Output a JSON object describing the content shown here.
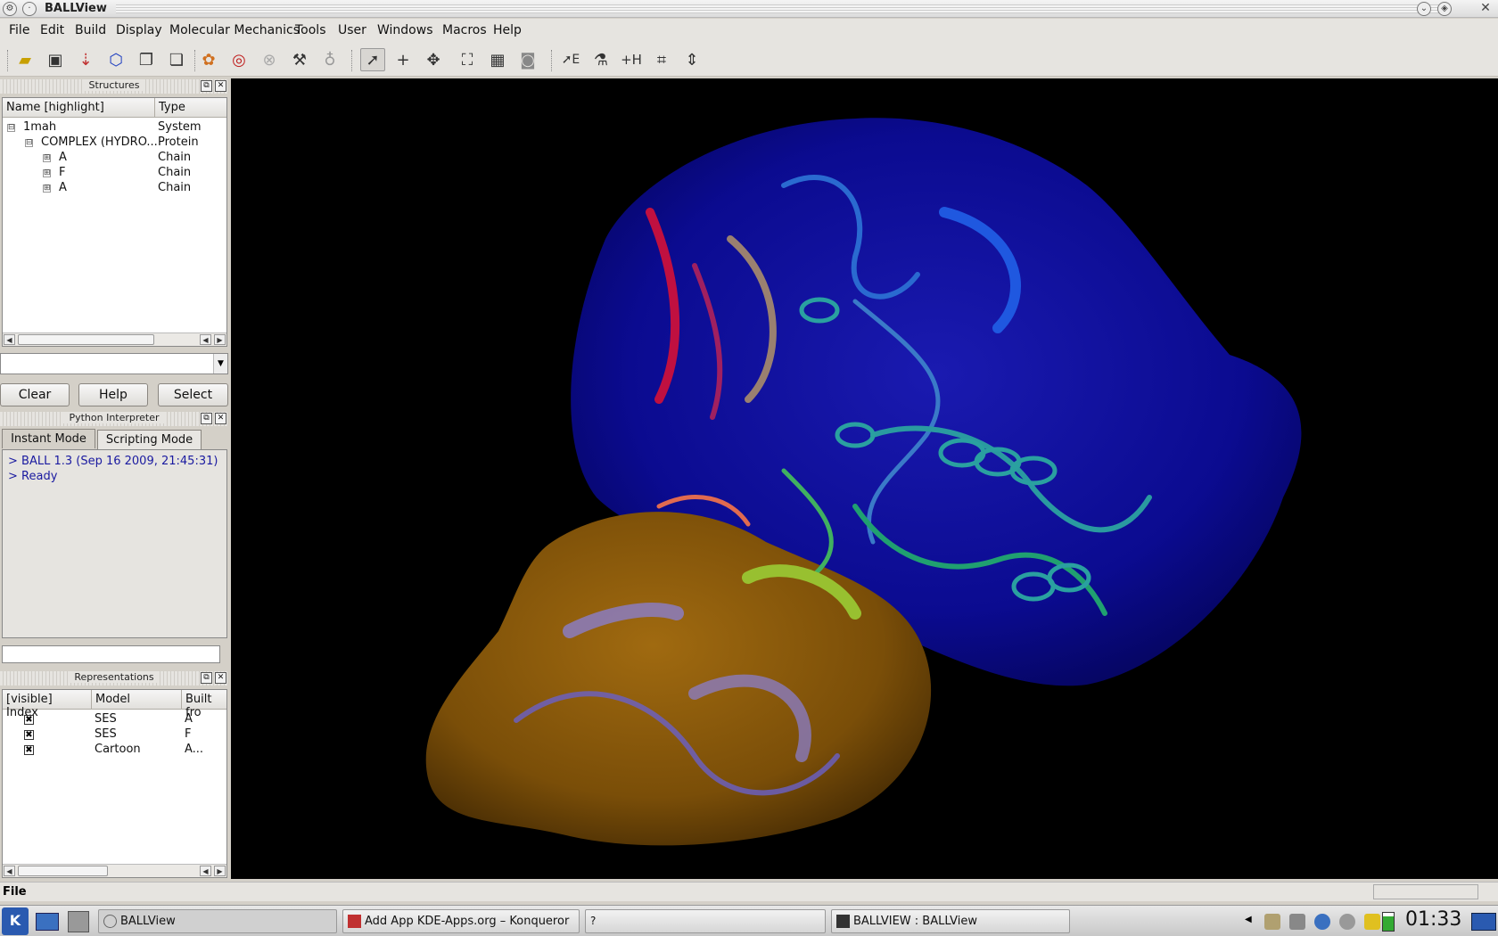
{
  "window": {
    "title": "BALLView"
  },
  "menu": [
    "File",
    "Edit",
    "Build",
    "Display",
    "Molecular Mechanics",
    "Tools",
    "User",
    "Windows",
    "Macros",
    "Help"
  ],
  "toolbar": {
    "icons": [
      "open-folder-icon",
      "save-icon",
      "download-molecule-icon",
      "hexagon-icon",
      "copy-window-icon",
      "clipboard-icon",
      "palette-icon",
      "target-icon",
      "stop-icon",
      "wrench-icon",
      "lightbulb-icon",
      "select-cursor-icon",
      "crosshair-icon",
      "move-icon",
      "fit-view-icon",
      "grid-icon",
      "camera-icon",
      "edit-mode-icon",
      "flask-icon",
      "add-hydrogens-icon",
      "plot-icon",
      "distance-icon"
    ]
  },
  "structures": {
    "panel_title": "Structures",
    "col_name": "Name [highlight]",
    "col_type": "Type",
    "rows": [
      {
        "name": "1mah",
        "type": "System",
        "expander": "⊟"
      },
      {
        "name": "COMPLEX (HYDRO...",
        "type": "Protein",
        "expander": "⊟"
      },
      {
        "name": "A",
        "type": "Chain",
        "expander": "⊞"
      },
      {
        "name": "F",
        "type": "Chain",
        "expander": "⊞"
      },
      {
        "name": "A",
        "type": "Chain",
        "expander": "⊞"
      }
    ],
    "search_value": "",
    "clear_label": "Clear",
    "help_label": "Help",
    "select_label": "Select"
  },
  "python": {
    "panel_title": "Python Interpreter",
    "tab_instant": "Instant Mode",
    "tab_scripting": "Scripting Mode",
    "output": [
      "> BALL 1.3 (Sep 16 2009, 21:45:31)",
      "> Ready"
    ],
    "input_value": ""
  },
  "representations": {
    "panel_title": "Representations",
    "col_index": "[visible] Index",
    "col_model": "Model",
    "col_built": "Built fro",
    "rows": [
      {
        "model": "SES",
        "built": "A",
        "visible": "✖"
      },
      {
        "model": "SES",
        "built": "F",
        "visible": "✖"
      },
      {
        "model": "Cartoon",
        "built": "A...",
        "visible": "✖"
      }
    ]
  },
  "status": {
    "text": "File"
  },
  "taskbar": {
    "tasks": [
      "BALLView",
      "Add App KDE-Apps.org – Konqueror",
      "",
      "BALLVIEW : BALLView"
    ],
    "clock": "01:33"
  },
  "colors": {
    "viewer_bg": "#000000",
    "protein_surface": "#0a0a8c",
    "ligand_surface": "#8a5a0a"
  }
}
